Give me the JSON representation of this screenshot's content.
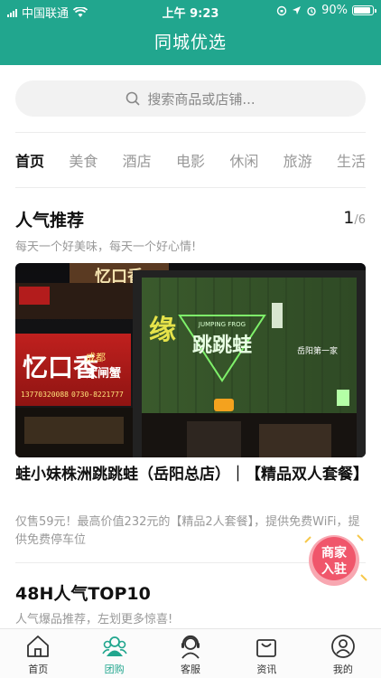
{
  "status_bar": {
    "carrier": "中国联通",
    "time": "上午 9:23",
    "battery": "90%",
    "battery_level": 0.9
  },
  "header": {
    "title": "同城优选"
  },
  "search": {
    "placeholder": "搜索商品或店铺..."
  },
  "tabs": [
    {
      "label": "首页",
      "active": true
    },
    {
      "label": "美食"
    },
    {
      "label": "酒店"
    },
    {
      "label": "电影"
    },
    {
      "label": "休闲"
    },
    {
      "label": "旅游"
    },
    {
      "label": "生活"
    }
  ],
  "featured": {
    "title": "人气推荐",
    "subtitle": "每天一个好美味，每天一个好心情!",
    "page_current": "1",
    "page_total": "/6",
    "photo_signs": {
      "restaurant_a": "忆口香",
      "restaurant_b": "忆口香",
      "restaurant_b_suffix": "大闸蟹",
      "restaurant_b_tag": "成都",
      "main_sign": "跳跳蛙",
      "main_sign_en": "JUMPING FROG",
      "side_text": "岳阳第一家",
      "left_vertical": "缘",
      "phone_1": "13770320088",
      "phone_2": "0730-8221777"
    },
    "product_title": "蛙小妹株洲跳跳蛙（岳阳总店）｜【精品双人套餐】",
    "product_desc": "仅售59元！最高价值232元的【精品2人套餐】，提供免费WiFi，提供免费停车位"
  },
  "top10": {
    "title": "48H人气TOP10",
    "subtitle": "人气爆品推荐，左划更多惊喜!"
  },
  "merchant_badge": {
    "line1": "商家",
    "line2": "入驻"
  },
  "bottom_nav": [
    {
      "label": "首页",
      "icon": "home-icon"
    },
    {
      "label": "团购",
      "icon": "group-buy-icon",
      "active": true
    },
    {
      "label": "客服",
      "icon": "customer-service-icon"
    },
    {
      "label": "资讯",
      "icon": "news-bag-icon"
    },
    {
      "label": "我的",
      "icon": "profile-icon"
    }
  ],
  "colors": {
    "brand": "#21a68e",
    "badge": "#f0566b"
  }
}
